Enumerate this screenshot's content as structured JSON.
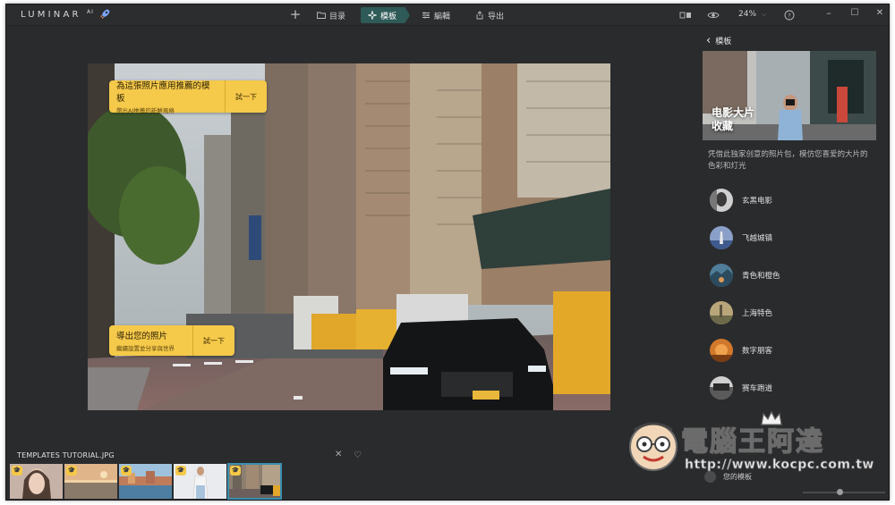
{
  "app": {
    "logo": "LUMINAR",
    "logo_sup": "AI",
    "rocket_icon": "rocket-icon"
  },
  "nav": {
    "add_icon": "+",
    "library": "目录",
    "templates": "模板",
    "edit": "編輯",
    "export": "导出"
  },
  "toolbar": {
    "zoom": "24%",
    "zoom_caret": "⌵",
    "minimize": "–",
    "maximize": "☐",
    "close": "✕"
  },
  "tips": {
    "top_title": "為這張照片應用推薦的模板",
    "top_sub": "帶出AI推薦的新鮮風格",
    "top_action": "試一下",
    "bottom_title": "導出您的照片",
    "bottom_sub": "繼續設置並分享與世界",
    "bottom_action": "試一下"
  },
  "filmstrip": {
    "title": "TEMPLATES TUTORIAL.JPG",
    "close": "✕",
    "heart": "♡",
    "badge": "🎓"
  },
  "panel": {
    "back_label": "模板",
    "back_arrow": "‹",
    "hero_line1": "电影大片",
    "hero_line2": "收藏",
    "description": "凭借此独家创意的照片包，模仿您喜爱的大片的色彩和灯光",
    "templates": [
      {
        "label": "玄黑电影"
      },
      {
        "label": "飞越城镇"
      },
      {
        "label": "青色和橙色"
      },
      {
        "label": "上海特色"
      },
      {
        "label": "数字朋客"
      },
      {
        "label": "赛车跑道"
      }
    ],
    "my_templates": "您的模板"
  },
  "watermark": {
    "text": "電腦王阿達",
    "url": "http://www.kocpc.com.tw"
  }
}
